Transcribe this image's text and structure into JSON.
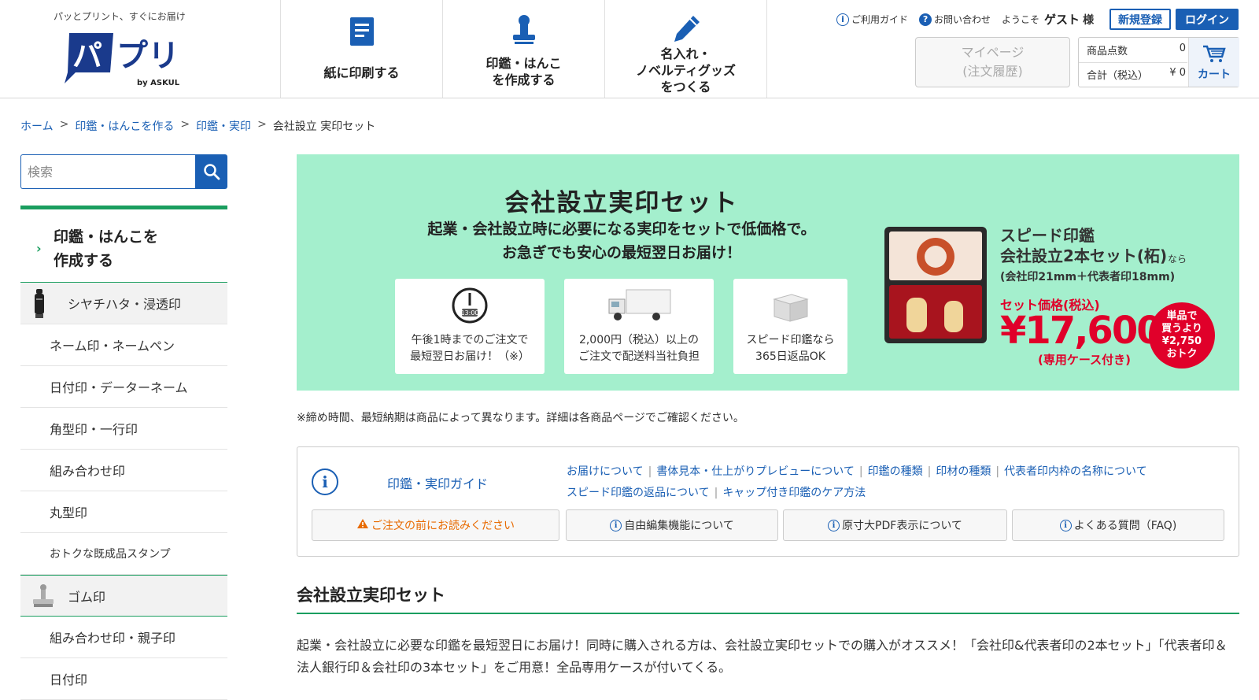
{
  "header": {
    "tagline": "パッとプリント、すぐにお届け",
    "logo_text": "パプリ",
    "logo_sub": "by ASKUL",
    "nav": [
      {
        "label": "紙に印刷する",
        "icon": "document-icon"
      },
      {
        "label": "印鑑・はんこ\nを作成する",
        "icon": "stamp-icon"
      },
      {
        "label": "名入れ・\nノベルティグッズ\nをつくる",
        "icon": "pen-icon"
      }
    ],
    "guide_link": "ご利用ガイド",
    "contact_link": "お問い合わせ",
    "welcome_prefix": "ようこそ",
    "welcome_name": "ゲスト",
    "welcome_suffix": "様",
    "register_label": "新規登録",
    "login_label": "ログイン",
    "mypage_label": "マイページ",
    "mypage_sub": "(注文履歴)",
    "cart": {
      "count_label": "商品点数",
      "count_value": "0",
      "total_label": "合計（税込）",
      "total_value": "¥ 0",
      "cart_label": "カート"
    }
  },
  "breadcrumb": {
    "items": [
      "ホーム",
      "印鑑・はんこを作る",
      "印鑑・実印"
    ],
    "current": "会社設立 実印セット",
    "sep": ">"
  },
  "sidebar": {
    "search_placeholder": "検索",
    "category_title": "印鑑・はんこを\n作成する",
    "items": [
      {
        "label": "シヤチハタ・浸透印",
        "group": true
      },
      {
        "label": "ネーム印・ネームペン"
      },
      {
        "label": "日付印・データーネーム"
      },
      {
        "label": "角型印・一行印"
      },
      {
        "label": "組み合わせ印"
      },
      {
        "label": "丸型印"
      },
      {
        "label": "おトクな既成品スタンプ"
      },
      {
        "label": "ゴム印",
        "group": true
      },
      {
        "label": "組み合わせ印・親子印"
      },
      {
        "label": "日付印"
      }
    ]
  },
  "banner": {
    "title": "会社設立実印セット",
    "subtitle": "起業・会社設立時に必要になる実印をセットで低価格で。\nお急ぎでも安心の最短翌日お届け！",
    "features": [
      {
        "icon": "clock-icon",
        "clock_text": "13:00",
        "text": "午後1時までのご注文で\n最短翌日お届け！（※）"
      },
      {
        "icon": "truck-icon",
        "text": "2,000円（税込）以上の\nご注文で配送料当社負担"
      },
      {
        "icon": "box-icon",
        "text": "スピード印鑑なら\n365日返品OK"
      }
    ],
    "product_name": "スピード印鑑\n会社設立2本セット(柘)",
    "product_nara": "なら",
    "product_spec": "(会社印21mm＋代表者印18mm)",
    "set_label": "セット価格(税込)",
    "price": "¥17,600",
    "case_note": "(専用ケース付き)",
    "badge": "単品で\n買うより\n¥2,750\nおトク"
  },
  "note": "※締め時間、最短納期は商品によって異なります。詳細は各商品ページでご確認ください。",
  "guide": {
    "title": "印鑑・実印ガイド",
    "links_row1": [
      "お届けについて",
      "書体見本・仕上がりプレビューについて",
      "印鑑の種類",
      "印材の種類",
      "代表者印内枠の名称について"
    ],
    "links_row2": [
      "スピード印鑑の返品について",
      "キャップ付き印鑑のケア方法"
    ],
    "link_sep": "|",
    "buttons": [
      {
        "label": "ご注文の前にお読みください",
        "icon": "warning-icon"
      },
      {
        "label": "自由編集機能について",
        "icon": "info-icon"
      },
      {
        "label": "原寸大PDF表示について",
        "icon": "info-icon"
      },
      {
        "label": "よくある質問（FAQ)",
        "icon": "info-icon"
      }
    ]
  },
  "section": {
    "title": "会社設立実印セット",
    "text": "起業・会社設立に必要な印鑑を最短翌日にお届け！同時に購入される方は、会社設立実印セットでの購入がオススメ！「会社印&代表者印の2本セット」「代表者印＆法人銀行印＆会社印の3本セット」をご用意！全品専用ケースが付いてくる。"
  },
  "colors": {
    "brand_blue": "#1a5fb4",
    "accent_green": "#1a9e5f",
    "banner_bg": "#a4efcd",
    "price_red": "#e0002a"
  }
}
